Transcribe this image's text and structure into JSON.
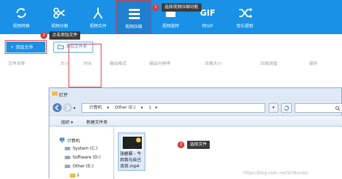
{
  "toolbar": {
    "items": [
      {
        "label": "视频转换",
        "icon": "convert-icon"
      },
      {
        "label": "视频分割",
        "icon": "scissors-icon"
      },
      {
        "label": "视频合并",
        "icon": "merge-icon"
      },
      {
        "label": "视频压缩",
        "icon": "compress-icon",
        "active": true
      },
      {
        "label": "视频旋转",
        "icon": "rotate-icon"
      },
      {
        "label": "转GIF",
        "icon": "gif-icon",
        "icon_text": "GIF"
      },
      {
        "label": "音乐提取",
        "icon": "shuffle-icon"
      }
    ]
  },
  "actions": {
    "add_file": "+ 添加文件",
    "add_folder": "添加文件夹"
  },
  "columns": [
    "文件名称",
    "大小",
    "时长",
    "输出格式",
    "输出分辨率",
    "压缩大小",
    "压缩进度",
    "操作"
  ],
  "callouts": [
    {
      "num": "1",
      "text": "选择视频压缩功能"
    },
    {
      "num": "2",
      "text": "点击添加文件"
    },
    {
      "num": "3",
      "text": "选择文件"
    }
  ],
  "dialog": {
    "title": "打开",
    "path": [
      "计算机",
      "Other (E:)",
      "1"
    ],
    "commands": [
      "组织 ▾",
      "新建文件夹"
    ],
    "nav": [
      "计算机",
      "System (C:)",
      "Software (D:)",
      "Other (E:)",
      "1"
    ],
    "file_name": "张碧晨 - 今后我与自己流浪.mp4"
  },
  "watermark": "https://blog.csdn.net/VCMambo",
  "colors": {
    "toolbar": "#1891e6",
    "accent": "#e23b3b"
  }
}
